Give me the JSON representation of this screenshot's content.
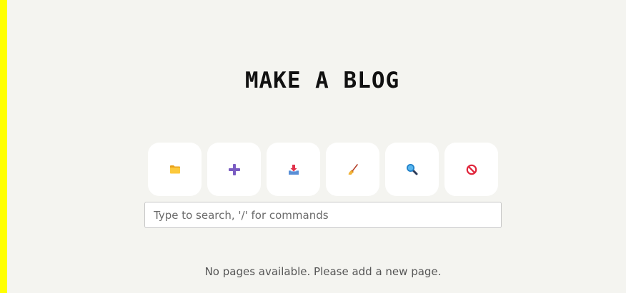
{
  "page": {
    "title": "MAKE A BLOG",
    "accent_bar_color": "#ffff00"
  },
  "toolbar": {
    "buttons": [
      {
        "icon": "folder-icon",
        "action": "open"
      },
      {
        "icon": "plus-icon",
        "action": "add"
      },
      {
        "icon": "inbox-download-icon",
        "action": "import"
      },
      {
        "icon": "broom-icon",
        "action": "clear"
      },
      {
        "icon": "magnifier-icon",
        "action": "search"
      },
      {
        "icon": "prohibited-icon",
        "action": "cancel"
      }
    ]
  },
  "search": {
    "value": "",
    "placeholder": "Type to search, '/' for commands"
  },
  "main": {
    "empty_message": "No pages available. Please add a new page."
  }
}
